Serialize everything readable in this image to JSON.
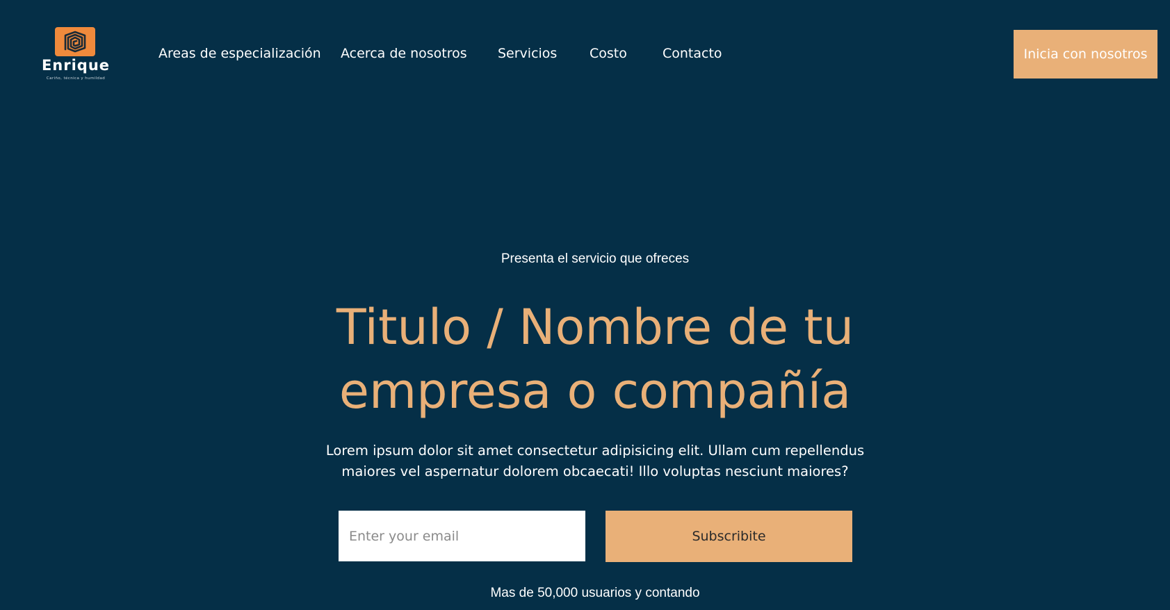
{
  "colors": {
    "background": "#052f47",
    "accent": "#e9b078",
    "logo_mark": "#f08a3c",
    "text": "#ffffff"
  },
  "header": {
    "logo": {
      "icon": "spiral-square-logo-icon",
      "name": "Enrique",
      "tagline": "Cariño, técnica y humildad"
    },
    "nav": [
      {
        "label": "Areas de especialización"
      },
      {
        "label": "Acerca de nosotros"
      },
      {
        "label": "Servicios"
      },
      {
        "label": "Costo"
      },
      {
        "label": "Contacto"
      }
    ],
    "cta_label": "Inicia con nosotros"
  },
  "hero": {
    "eyebrow": "Presenta el servicio que ofreces",
    "title_line1": "Titulo / Nombre de tu",
    "title_line2": "empresa o compañía",
    "description_line1": "Lorem ipsum dolor sit amet consectetur adipisicing elit. Ullam cum repellendus",
    "description_line2": "maiores vel aspernatur dolorem obcaecati! Illo voluptas nesciunt maiores?",
    "email_placeholder": "Enter your email",
    "email_value": "",
    "subscribe_label": "Subscribite",
    "users_note": "Mas de 50,000 usuarios y contando"
  }
}
